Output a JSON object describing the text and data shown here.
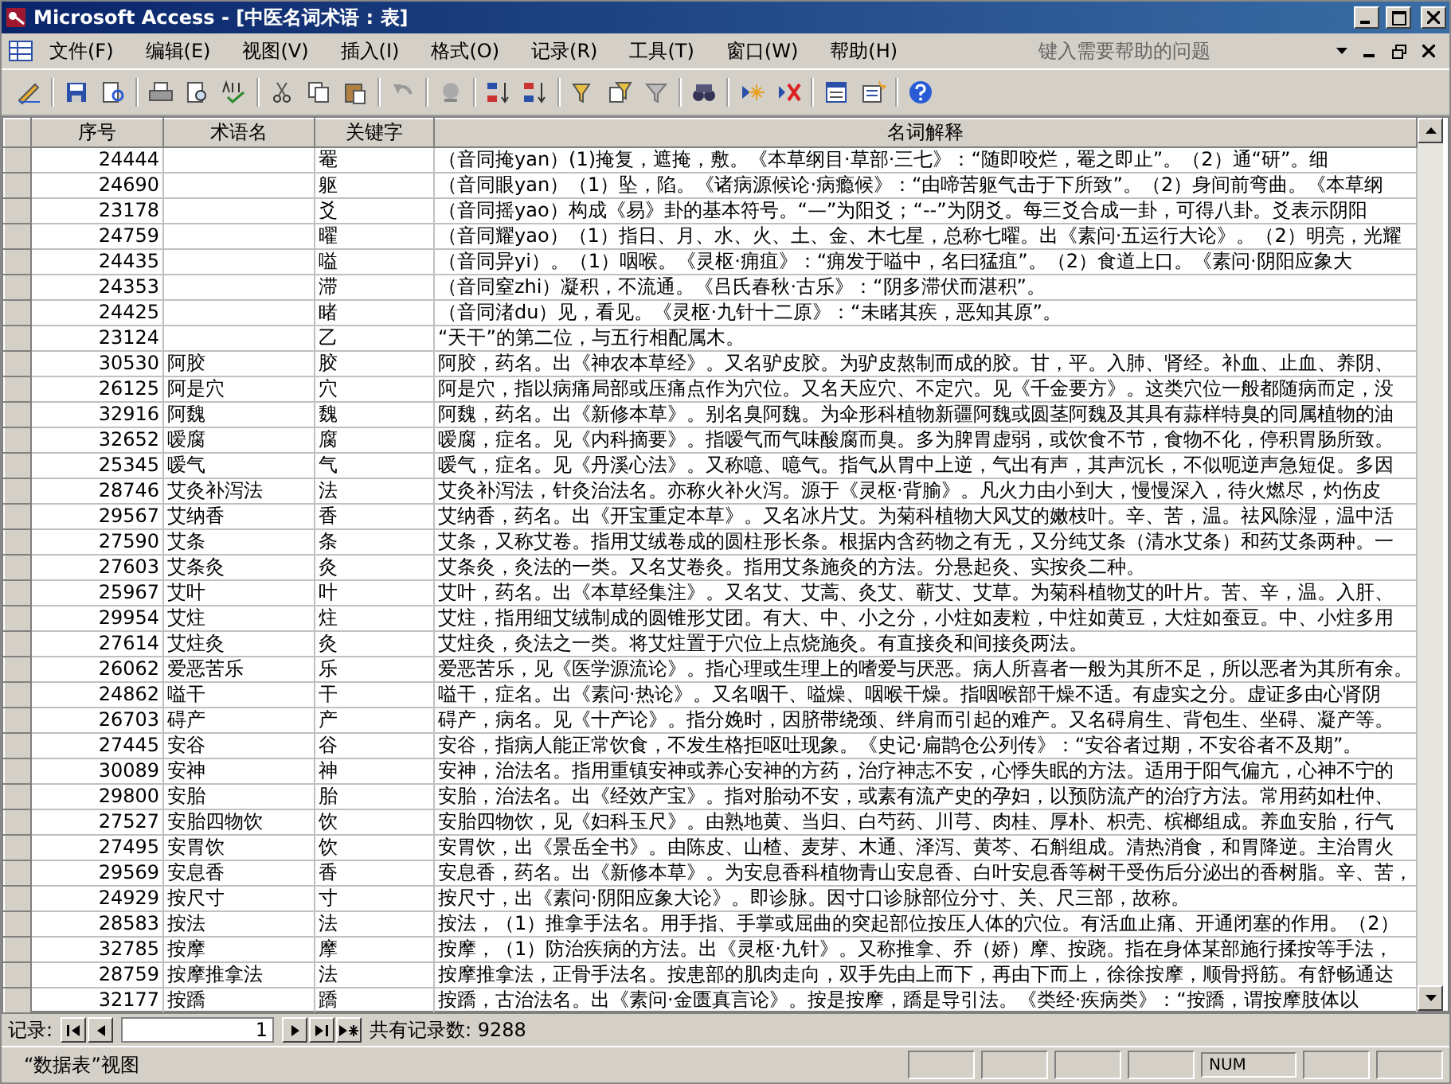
{
  "window": {
    "title": "Microsoft Access - [中医名词术语 : 表]"
  },
  "menu": [
    {
      "label": "文件(F)"
    },
    {
      "label": "编辑(E)"
    },
    {
      "label": "视图(V)"
    },
    {
      "label": "插入(I)"
    },
    {
      "label": "格式(O)"
    },
    {
      "label": "记录(R)"
    },
    {
      "label": "工具(T)"
    },
    {
      "label": "窗口(W)"
    },
    {
      "label": "帮助(H)"
    }
  ],
  "help_box": {
    "placeholder": "键入需要帮助的问题"
  },
  "table": {
    "columns": [
      "序号",
      "术语名",
      "关键字",
      "名词解释"
    ],
    "rows": [
      {
        "id": "24444",
        "key": "罨",
        "explanation": "（音同掩yan）(1)掩复，遮掩，敷。《本草纲目·草部·三七》：“随即咬烂，罨之即止”。（2）通“研”。细"
      },
      {
        "id": "24690",
        "key": "躯",
        "explanation": "（音同眼yan）（1）坠，陷。《诸病源候论·病瘾候》：“由啼苦躯气击于下所致”。（2）身间前弯曲。《本草纲"
      },
      {
        "id": "23178",
        "key": "爻",
        "explanation": "（音同摇yao）构成《易》卦的基本符号。“—”为阳爻；“--”为阴爻。每三爻合成一卦，可得八卦。爻表示阴阳"
      },
      {
        "id": "24759",
        "key": "曜",
        "explanation": "（音同耀yao）（1）指日、月、水、火、土、金、木七星，总称七曜。出《素问·五运行大论》。（2）明亮，光耀"
      },
      {
        "id": "24435",
        "key": "嗌",
        "explanation": "（音同异yi）。（1）咽喉。《灵枢·痈疽》：“痈发于嗌中，名曰猛疽”。（2）食道上口。《素问·阴阳应象大"
      },
      {
        "id": "24353",
        "key": "滞",
        "explanation": "（音同窒zhi）凝积，不流通。《吕氏春秋·古乐》：“阴多滞伏而湛积”。"
      },
      {
        "id": "24425",
        "key": "睹",
        "explanation": "（音同渚du）见，看见。《灵枢·九针十二原》：“未睹其疾，恶知其原”。"
      },
      {
        "id": "23124",
        "key": "乙",
        "explanation": "“天干”的第二位，与五行相配属木。"
      },
      {
        "id": "30530",
        "term": "阿胶",
        "key": "胶",
        "explanation": "阿胶，药名。出《神农本草经》。又名驴皮胶。为驴皮熬制而成的胶。甘，平。入肺、肾经。补血、止血、养阴、"
      },
      {
        "id": "26125",
        "term": "阿是穴",
        "key": "穴",
        "explanation": "阿是穴，指以病痛局部或压痛点作为穴位。又名天应穴、不定穴。见《千金要方》。这类穴位一般都随病而定，没"
      },
      {
        "id": "32916",
        "term": "阿魏",
        "key": "魏",
        "explanation": "阿魏，药名。出《新修本草》。别名臭阿魏。为伞形科植物新疆阿魏或圆茎阿魏及其具有蒜样特臭的同属植物的油"
      },
      {
        "id": "32652",
        "term": "嗳腐",
        "key": "腐",
        "explanation": "嗳腐，症名。见《内科摘要》。指嗳气而气味酸腐而臭。多为脾胃虚弱，或饮食不节，食物不化，停积胃肠所致。"
      },
      {
        "id": "25345",
        "term": "嗳气",
        "key": "气",
        "explanation": "嗳气，症名。见《丹溪心法》。又称噫、噫气。指气从胃中上逆，气出有声，其声沉长，不似呃逆声急短促。多因"
      },
      {
        "id": "28746",
        "term": "艾灸补泻法",
        "key": "法",
        "explanation": "艾灸补泻法，针灸治法名。亦称火补火泻。源于《灵枢·背腧》。凡火力由小到大，慢慢深入，待火燃尽，灼伤皮"
      },
      {
        "id": "29567",
        "term": "艾纳香",
        "key": "香",
        "explanation": "艾纳香，药名。出《开宝重定本草》。又名冰片艾。为菊科植物大风艾的嫩枝叶。辛、苦，温。祛风除湿，温中活"
      },
      {
        "id": "27590",
        "term": "艾条",
        "key": "条",
        "explanation": "艾条，又称艾卷。指用艾绒卷成的圆柱形长条。根据内含药物之有无，又分纯艾条（清水艾条）和药艾条两种。一"
      },
      {
        "id": "27603",
        "term": "艾条灸",
        "key": "灸",
        "explanation": "艾条灸，灸法的一类。又名艾卷灸。指用艾条施灸的方法。分悬起灸、实按灸二种。"
      },
      {
        "id": "25967",
        "term": "艾叶",
        "key": "叶",
        "explanation": "艾叶，药名。出《本草经集注》。又名艾、艾蒿、灸艾、蕲艾、艾草。为菊科植物艾的叶片。苦、辛，温。入肝、"
      },
      {
        "id": "29954",
        "term": "艾炷",
        "key": "炷",
        "explanation": "艾炷，指用细艾绒制成的圆锥形艾团。有大、中、小之分，小炷如麦粒，中炷如黄豆，大炷如蚕豆。中、小炷多用"
      },
      {
        "id": "27614",
        "term": "艾炷灸",
        "key": "灸",
        "explanation": "艾炷灸，灸法之一类。将艾炷置于穴位上点烧施灸。有直接灸和间接灸两法。"
      },
      {
        "id": "26062",
        "term": "爱恶苦乐",
        "key": "乐",
        "explanation": "爱恶苦乐，见《医学源流论》。指心理或生理上的嗜爱与厌恶。病人所喜者一般为其所不足，所以恶者为其所有余。"
      },
      {
        "id": "24862",
        "term": "嗌干",
        "key": "干",
        "explanation": "嗌干，症名。出《素问·热论》。又名咽干、嗌燥、咽喉干燥。指咽喉部干燥不适。有虚实之分。虚证多由心肾阴"
      },
      {
        "id": "26703",
        "term": "碍产",
        "key": "产",
        "explanation": "碍产，病名。见《十产论》。指分娩时，因脐带绕颈、绊肩而引起的难产。又名碍肩生、背包生、坐碍、凝产等。"
      },
      {
        "id": "27445",
        "term": "安谷",
        "key": "谷",
        "explanation": "安谷，指病人能正常饮食，不发生格拒呕吐现象。《史记·扁鹊仓公列传》：“安谷者过期，不安谷者不及期”。"
      },
      {
        "id": "30089",
        "term": "安神",
        "key": "神",
        "explanation": "安神，治法名。指用重镇安神或养心安神的方药，治疗神志不安，心悸失眠的方法。适用于阳气偏亢，心神不宁的"
      },
      {
        "id": "29800",
        "term": "安胎",
        "key": "胎",
        "explanation": "安胎，治法名。出《经效产宝》。指对胎动不安，或素有流产史的孕妇，以预防流产的治疗方法。常用药如杜仲、"
      },
      {
        "id": "27527",
        "term": "安胎四物饮",
        "key": "饮",
        "explanation": "安胎四物饮，见《妇科玉尺》。由熟地黄、当归、白芍药、川芎、肉桂、厚朴、枳壳、槟榔组成。养血安胎，行气"
      },
      {
        "id": "27495",
        "term": "安胃饮",
        "key": "饮",
        "explanation": "安胃饮，出《景岳全书》。由陈皮、山楂、麦芽、木通、泽泻、黄芩、石斛组成。清热消食，和胃降逆。主治胃火"
      },
      {
        "id": "29569",
        "term": "安息香",
        "key": "香",
        "explanation": "安息香，药名。出《新修本草》。为安息香科植物青山安息香、白叶安息香等树干受伤后分泌出的香树脂。辛、苦，"
      },
      {
        "id": "24929",
        "term": "按尺寸",
        "key": "寸",
        "explanation": "按尺寸，出《素问·阴阳应象大论》。即诊脉。因寸口诊脉部位分寸、关、尺三部，故称。"
      },
      {
        "id": "28583",
        "term": "按法",
        "key": "法",
        "explanation": "按法，（1）推拿手法名。用手指、手掌或屈曲的突起部位按压人体的穴位。有活血止痛、开通闭塞的作用。（2）"
      },
      {
        "id": "32785",
        "term": "按摩",
        "key": "摩",
        "explanation": "按摩，（1）防治疾病的方法。出《灵枢·九针》。又称推拿、乔（娇）摩、按跷。指在身体某部施行揉按等手法，"
      },
      {
        "id": "28759",
        "term": "按摩推拿法",
        "key": "法",
        "explanation": "按摩推拿法，正骨手法名。按患部的肌肉走向，双手先由上而下，再由下而上，徐徐按摩，顺骨捋筋。有舒畅通达"
      },
      {
        "id": "32177",
        "term": "按蹻",
        "key": "蹻",
        "explanation": "按蹻，古治法名。出《素问·金匮真言论》。按是按摩，蹻是导引法。《类经·疾病类》：“按蹻，谓按摩肢体以"
      }
    ]
  },
  "navigator": {
    "label": "记录:",
    "current": "1",
    "total": "共有记录数: 9288"
  },
  "status_bar": {
    "view": "“数据表”视图",
    "indicator": "NUM"
  }
}
